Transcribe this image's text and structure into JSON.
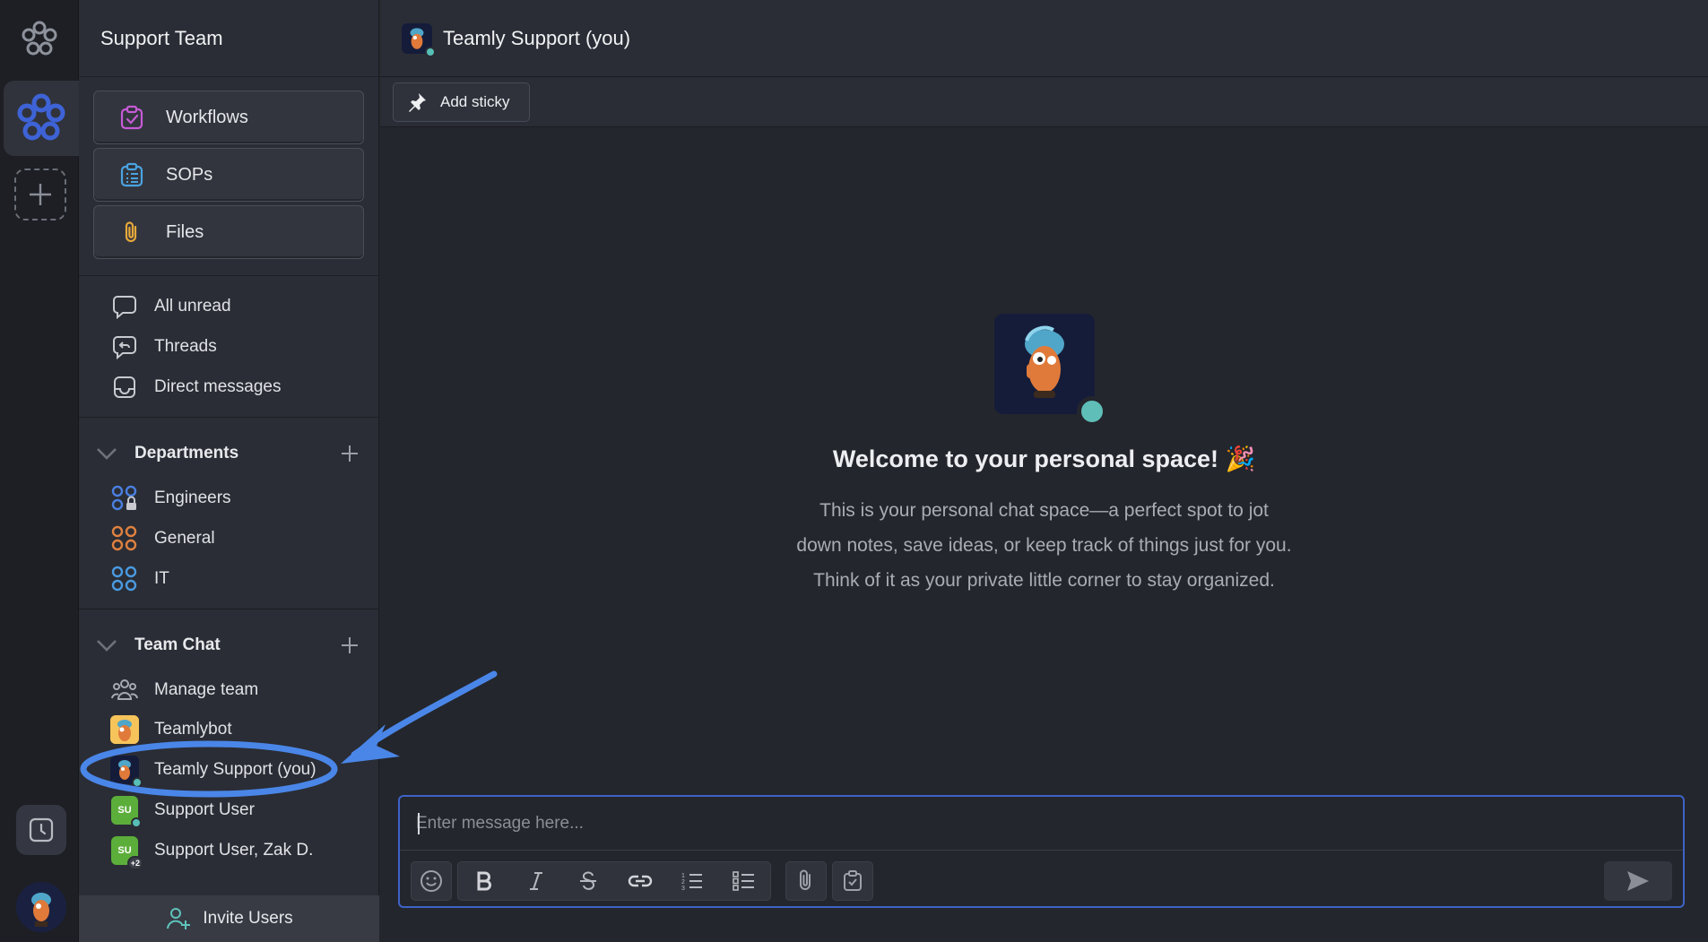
{
  "workspace": {
    "name": "Support Team"
  },
  "tools": [
    {
      "label": "Workflows",
      "icon": "workflow-icon"
    },
    {
      "label": "SOPs",
      "icon": "clipboard-list-icon"
    },
    {
      "label": "Files",
      "icon": "paperclip-icon"
    }
  ],
  "nav": [
    {
      "label": "All unread",
      "icon": "chat-bubble-icon"
    },
    {
      "label": "Threads",
      "icon": "threads-icon"
    },
    {
      "label": "Direct messages",
      "icon": "inbox-icon"
    }
  ],
  "departments": {
    "title": "Departments",
    "items": [
      {
        "label": "Engineers",
        "icon": "private-channel-icon"
      },
      {
        "label": "General",
        "icon": "channel-icon"
      },
      {
        "label": "IT",
        "icon": "channel-icon"
      }
    ]
  },
  "team_chat": {
    "title": "Team Chat",
    "manage_label": "Manage team",
    "items": [
      {
        "label": "Teamlybot",
        "avatar": "bot-avatar"
      },
      {
        "label": "Teamly Support (you)",
        "avatar": "user-avatar"
      },
      {
        "label": "Support User",
        "initials": "SU"
      },
      {
        "label": "Support User, Zak D.",
        "initials": "SU",
        "badge": "+2"
      }
    ]
  },
  "invite_label": "Invite Users",
  "chat": {
    "title": "Teamly Support (you)",
    "add_sticky": "Add sticky",
    "welcome_title": "Welcome to your personal space! 🎉",
    "welcome_lines": [
      "This is your personal chat space—a perfect spot to jot",
      "down notes, save ideas, or keep track of things just for you.",
      "Think of it as your private little corner to stay organized."
    ],
    "placeholder": "Enter message here..."
  },
  "colors": {
    "accent": "#3e63c7",
    "online": "#57bfb6",
    "annotation": "#4a86e8"
  }
}
